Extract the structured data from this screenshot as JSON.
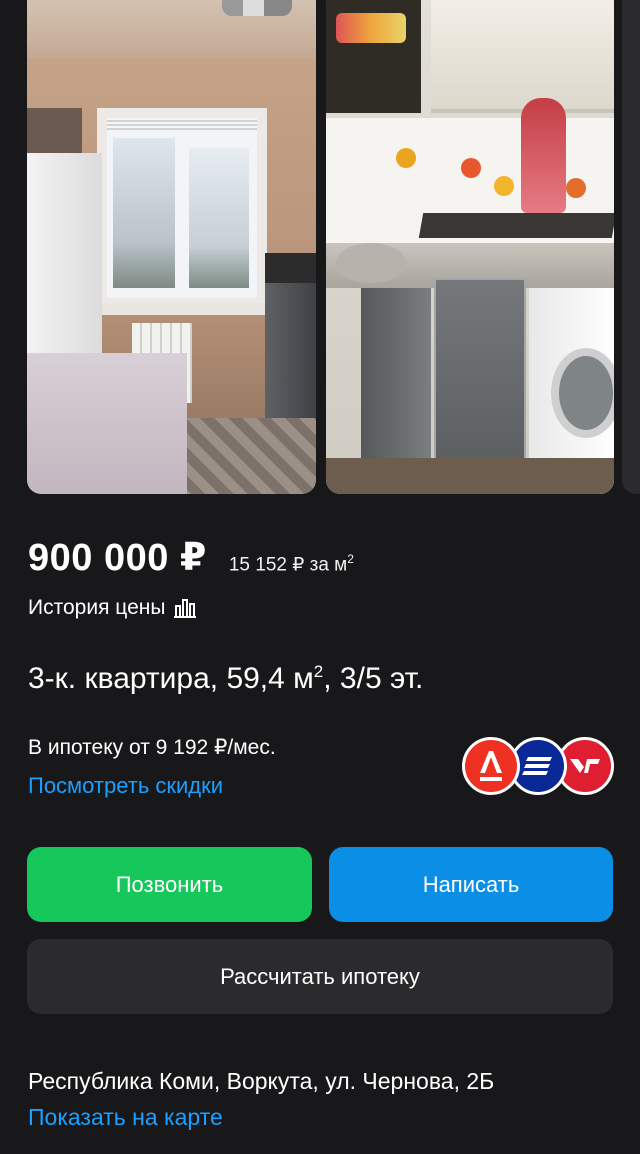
{
  "gallery": {
    "photos": [
      "kitchen-window-photo",
      "kitchen-counter-photo"
    ]
  },
  "listing": {
    "price": "900 000 ₽",
    "price_per_sqm": "15 152 ₽ за м",
    "price_per_sqm_unit_sup": "2",
    "price_history_label": "История цены",
    "title_main": "3-к. квартира, 59,4 м",
    "title_sup": "2",
    "title_tail": ", 3/5 эт.",
    "mortgage_text": "В ипотеку от 9 192 ₽/мес.",
    "discounts_link": "Посмотреть скидки",
    "banks": [
      "alfa-bank-logo",
      "vtb-logo",
      "pochta-bank-logo"
    ]
  },
  "actions": {
    "call_label": "Позвонить",
    "write_label": "Написать",
    "calc_label": "Рассчитать ипотеку"
  },
  "location": {
    "address": "Республика Коми, Воркута, ул. Чернова, 2Б",
    "map_link": "Показать на карте"
  },
  "colors": {
    "background": "#18181a",
    "call_button": "#16c75b",
    "write_button": "#0a8ee6",
    "link": "#1aa0ff",
    "secondary_button": "#2b2b2d"
  }
}
